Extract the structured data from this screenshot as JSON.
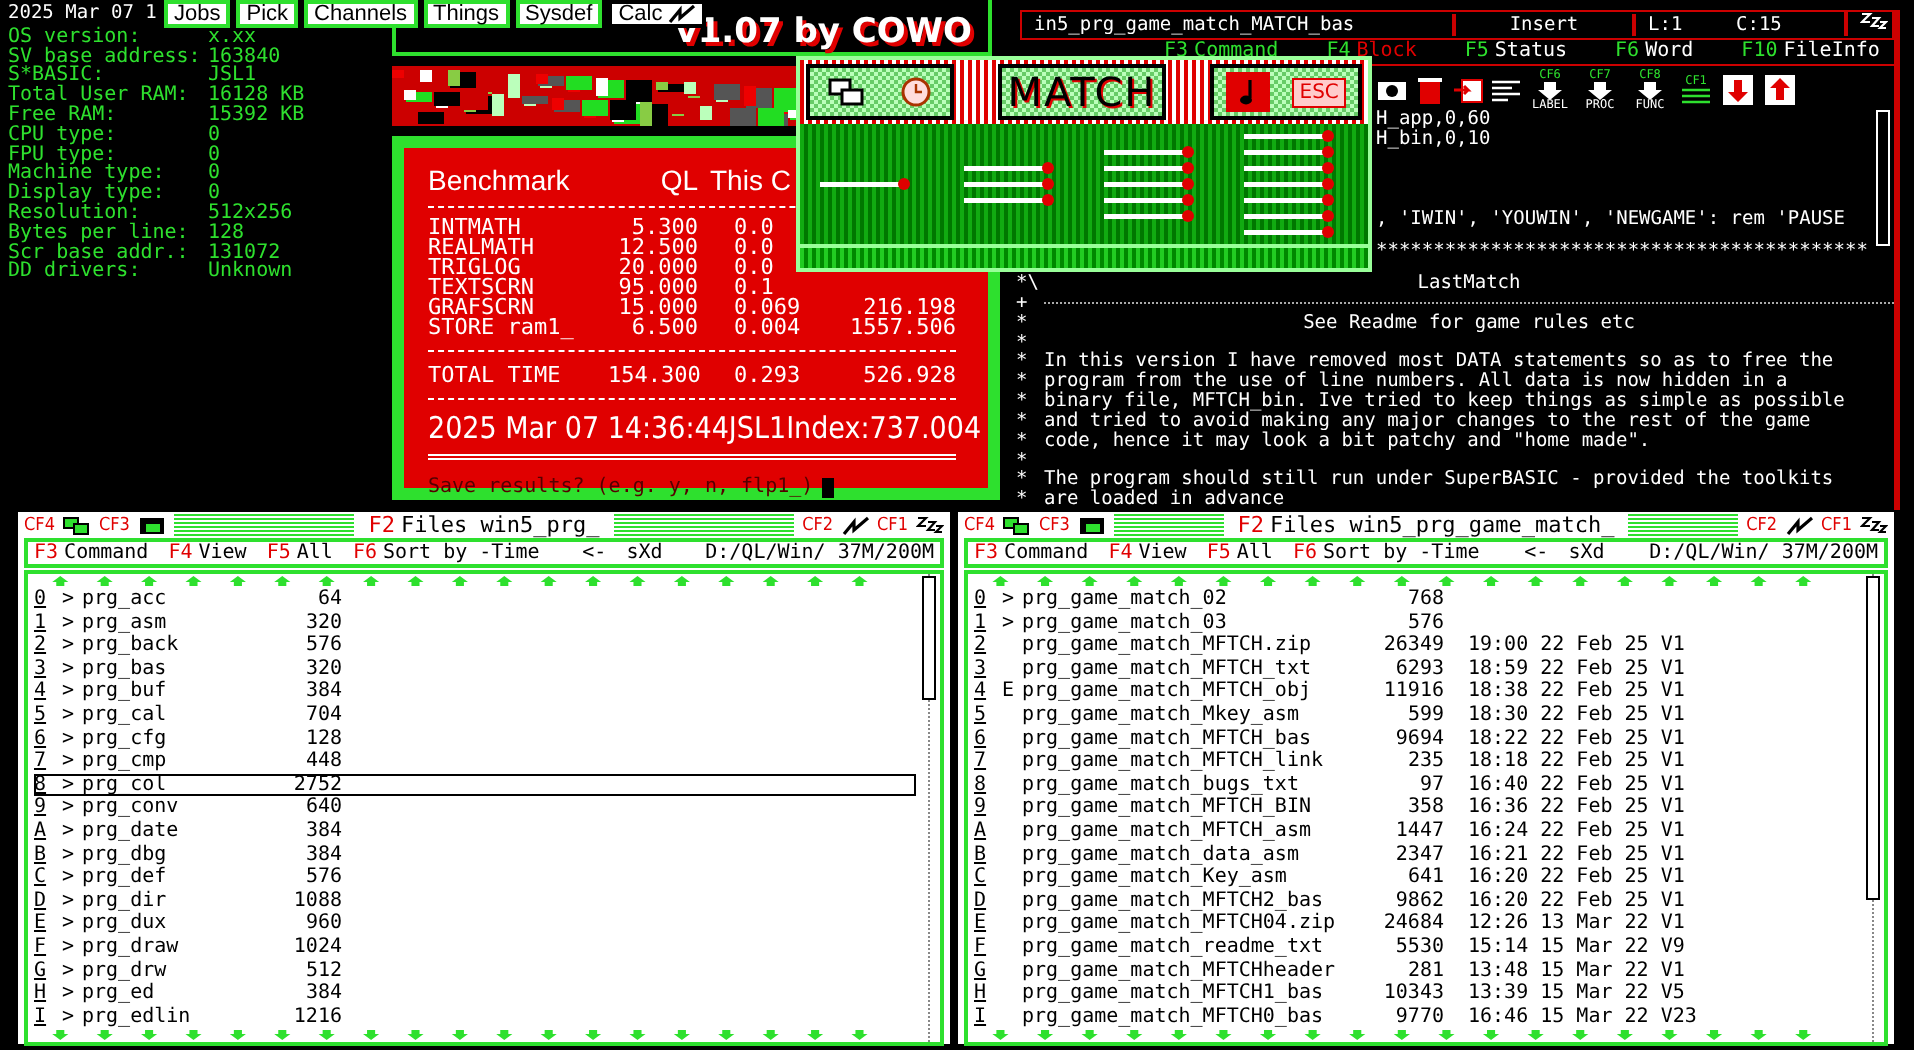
{
  "clock": {
    "text": "2025 Mar 07 1"
  },
  "launcher": {
    "buttons": [
      {
        "label": "Jobs",
        "kind": "text"
      },
      {
        "label": "Pick",
        "kind": "text"
      },
      {
        "label": "Channels",
        "kind": "text"
      },
      {
        "label": "Things",
        "kind": "text"
      },
      {
        "label": "Sysdef",
        "kind": "text"
      },
      {
        "label": "Calc",
        "kind": "icon"
      }
    ]
  },
  "sysinfo": {
    "rows": [
      {
        "label": "OS version:",
        "value": "x.xx"
      },
      {
        "label": "SV base address:",
        "value": "163840"
      },
      {
        "label": "S*BASIC:",
        "value": "JSL1"
      },
      {
        "label": "Total User RAM:",
        "value": "16128 KB"
      },
      {
        "label": "Free RAM:",
        "value": "15392 KB"
      },
      {
        "label": "CPU type:",
        "value": "0"
      },
      {
        "label": "FPU type:",
        "value": "0"
      },
      {
        "label": "Machine type:",
        "value": "0"
      },
      {
        "label": "Display type:",
        "value": "0"
      },
      {
        "label": "Resolution:",
        "value": "512x256"
      },
      {
        "label": "Bytes per line:",
        "value": "128"
      },
      {
        "label": "Scr base addr.:",
        "value": "131072"
      },
      {
        "label": "DD drivers:",
        "value": "Unknown"
      }
    ]
  },
  "title_window": {
    "title": "v1.07 by COWO"
  },
  "benchmark": {
    "title": "Benchmark",
    "col_ql": "QL",
    "col_this": "This C",
    "rows": [
      {
        "name": "INTMATH",
        "ql": "5.300",
        "this": "0.0"
      },
      {
        "name": "REALMATH",
        "ql": "12.500",
        "this": "0.0"
      },
      {
        "name": "TRIGLOG",
        "ql": "20.000",
        "this": "0.0"
      },
      {
        "name": "TEXTSCRN",
        "ql": "95.000",
        "this": "0.1"
      },
      {
        "name": "GRAFSCRN",
        "ql": "15.000",
        "this": "0.069",
        "index": "216.198"
      },
      {
        "name": "STORE ram1_",
        "ql": "6.500",
        "this": "0.004",
        "index": "1557.506"
      }
    ],
    "total": {
      "name": "TOTAL TIME",
      "ql": "154.300",
      "this": "0.293",
      "index": "526.928"
    },
    "result": {
      "date": "2025 Mar 07 14:36:44",
      "system": "JSL1",
      "label": "Index:",
      "value": "737.004"
    },
    "prompt": "Save results? (e.g. y, n, flp1_)"
  },
  "match_window": {
    "title": "MATCH",
    "esc": "ESC"
  },
  "editor": {
    "filename": "in5_prg_game_match_MATCH_bas",
    "mode": "Insert",
    "line": "L:1",
    "column": "C:15",
    "menu": [
      {
        "key": "F3",
        "label": "Command",
        "kind": "active"
      },
      {
        "key": "F4",
        "label": "Block",
        "kind": "marked"
      },
      {
        "key": "F5",
        "label": "Status",
        "kind": "plain"
      },
      {
        "key": "F6",
        "label": "Word",
        "kind": "plain"
      },
      {
        "key": "F10",
        "label": "FileInfo",
        "kind": "plain"
      }
    ],
    "toolbar": [
      {
        "key": "CF6",
        "label": "LABEL"
      },
      {
        "key": "CF7",
        "label": "PROC"
      },
      {
        "key": "CF8",
        "label": "FUNC"
      },
      {
        "key": "CF1"
      }
    ],
    "clipped_lines": [
      "H_app,0,60",
      "H_bin,0,10",
      ", 'IWIN', 'YOUWIN', 'NEWGAME': rem 'PAUSE",
      "*******************************************"
    ],
    "lines": [
      {
        "marker": "*\\",
        "text": "LastMatch",
        "kind": "center"
      },
      {
        "marker": "+",
        "kind": "rule"
      },
      {
        "marker": "*",
        "text": "See Readme for game rules etc",
        "kind": "center"
      },
      {
        "marker": "*",
        "kind": "blank"
      },
      {
        "marker": "*",
        "text": "In this version I have removed most DATA statements so as to free the",
        "kind": "left"
      },
      {
        "marker": "*",
        "text": "program from the use of line numbers. All data is now hidden in a",
        "kind": "left"
      },
      {
        "marker": "*",
        "text": "binary file, MFTCH_bin. Ive tried to keep things as simple as possible",
        "kind": "left"
      },
      {
        "marker": "*",
        "text": "and tried to avoid making any major changes to the rest of the game",
        "kind": "left"
      },
      {
        "marker": "*",
        "text": "code, hence it may look a bit patchy and \"home made\".",
        "kind": "left"
      },
      {
        "marker": "*",
        "kind": "blank"
      },
      {
        "marker": "*",
        "text": "The program should still run under SuperBASIC - provided the toolkits",
        "kind": "left"
      },
      {
        "marker": "*",
        "text": "are loaded in advance",
        "kind": "left"
      }
    ]
  },
  "file_windows": [
    {
      "title": {
        "key": "F2",
        "text": "Files win5_prg_"
      },
      "shortcuts": [
        "CF4",
        "CF3",
        "CF2",
        "CF1"
      ],
      "menu": [
        {
          "key": "F3",
          "label": "Command"
        },
        {
          "key": "F4",
          "label": "View"
        },
        {
          "key": "F5",
          "label": "All"
        },
        {
          "key": "F6",
          "label": "Sort by -Time"
        }
      ],
      "back": "<-",
      "mode": "sXd",
      "path": "D:/QL/Win/ 37M/200M",
      "rows": [
        {
          "key": "0",
          "marker": ">",
          "name": "prg_acc",
          "size": "64",
          "selected": false
        },
        {
          "key": "1",
          "marker": ">",
          "name": "prg_asm",
          "size": "320",
          "selected": false
        },
        {
          "key": "2",
          "marker": ">",
          "name": "prg_back",
          "size": "576",
          "selected": false
        },
        {
          "key": "3",
          "marker": ">",
          "name": "prg_bas",
          "size": "320",
          "selected": false
        },
        {
          "key": "4",
          "marker": ">",
          "name": "prg_buf",
          "size": "384",
          "selected": false
        },
        {
          "key": "5",
          "marker": ">",
          "name": "prg_cal",
          "size": "704",
          "selected": false
        },
        {
          "key": "6",
          "marker": ">",
          "name": "prg_cfg",
          "size": "128",
          "selected": false
        },
        {
          "key": "7",
          "marker": ">",
          "name": "prg_cmp",
          "size": "448",
          "selected": false
        },
        {
          "key": "8",
          "marker": ">",
          "name": "prg_col",
          "size": "2752",
          "selected": true
        },
        {
          "key": "9",
          "marker": ">",
          "name": "prg_conv",
          "size": "640",
          "selected": false
        },
        {
          "key": "A",
          "marker": ">",
          "name": "prg_date",
          "size": "384",
          "selected": false
        },
        {
          "key": "B",
          "marker": ">",
          "name": "prg_dbg",
          "size": "384",
          "selected": false
        },
        {
          "key": "C",
          "marker": ">",
          "name": "prg_def",
          "size": "576",
          "selected": false
        },
        {
          "key": "D",
          "marker": ">",
          "name": "prg_dir",
          "size": "1088",
          "selected": false
        },
        {
          "key": "E",
          "marker": ">",
          "name": "prg_dux",
          "size": "960",
          "selected": false
        },
        {
          "key": "F",
          "marker": ">",
          "name": "prg_draw",
          "size": "1024",
          "selected": false
        },
        {
          "key": "G",
          "marker": ">",
          "name": "prg_drw",
          "size": "512",
          "selected": false
        },
        {
          "key": "H",
          "marker": ">",
          "name": "prg_ed",
          "size": "384",
          "selected": false
        },
        {
          "key": "I",
          "marker": ">",
          "name": "prg_edlin",
          "size": "1216",
          "selected": false
        }
      ]
    },
    {
      "title": {
        "key": "F2",
        "text": "Files win5_prg_game_match_"
      },
      "shortcuts": [
        "CF4",
        "CF3",
        "CF2",
        "CF1"
      ],
      "menu": [
        {
          "key": "F3",
          "label": "Command"
        },
        {
          "key": "F4",
          "label": "View"
        },
        {
          "key": "F5",
          "label": "All"
        },
        {
          "key": "F6",
          "label": "Sort by -Time"
        }
      ],
      "back": "<-",
      "mode": "sXd",
      "path": "D:/QL/Win/ 37M/200M",
      "rows": [
        {
          "key": "0",
          "marker": ">",
          "name": "prg_game_match_02",
          "size": "768",
          "selected": false
        },
        {
          "key": "1",
          "marker": ">",
          "name": "prg_game_match_03",
          "size": "576",
          "selected": false
        },
        {
          "key": "2",
          "name": "prg_game_match_MFTCH.zip",
          "size": "26349",
          "info": "19:00 22 Feb 25 V1",
          "selected": false
        },
        {
          "key": "3",
          "name": "prg_game_match_MFTCH_txt",
          "size": "6293",
          "info": "18:59 22 Feb 25 V1",
          "selected": false
        },
        {
          "key": "4",
          "marker": "E",
          "name": "prg_game_match_MFTCH_obj",
          "size": "11916",
          "info": "18:38 22 Feb 25 V1",
          "selected": false
        },
        {
          "key": "5",
          "name": "prg_game_match_Mkey_asm",
          "size": "599",
          "info": "18:30 22 Feb 25 V1",
          "selected": false
        },
        {
          "key": "6",
          "name": "prg_game_match_MFTCH_bas",
          "size": "9694",
          "info": "18:22 22 Feb 25 V1",
          "selected": false
        },
        {
          "key": "7",
          "name": "prg_game_match_MFTCH_link",
          "size": "235",
          "info": "18:18 22 Feb 25 V1",
          "selected": false
        },
        {
          "key": "8",
          "name": "prg_game_match_bugs_txt",
          "size": "97",
          "info": "16:40 22 Feb 25 V1",
          "selected": false
        },
        {
          "key": "9",
          "name": "prg_game_match_MFTCH_BIN",
          "size": "358",
          "info": "16:36 22 Feb 25 V1",
          "selected": false
        },
        {
          "key": "A",
          "name": "prg_game_match_MFTCH_asm",
          "size": "1447",
          "info": "16:24 22 Feb 25 V1",
          "selected": false
        },
        {
          "key": "B",
          "name": "prg_game_match_data_asm",
          "size": "2347",
          "info": "16:21 22 Feb 25 V1",
          "selected": false
        },
        {
          "key": "C",
          "name": "prg_game_match_Key_asm",
          "size": "641",
          "info": "16:20 22 Feb 25 V1",
          "selected": false
        },
        {
          "key": "D",
          "name": "prg_game_match_MFTCH2_bas",
          "size": "9862",
          "info": "16:20 22 Feb 25 V1",
          "selected": false
        },
        {
          "key": "E",
          "name": "prg_game_match_MFTCH04.zip",
          "size": "24684",
          "info": "12:26 13 Mar 22 V1",
          "selected": false
        },
        {
          "key": "F",
          "name": "prg_game_match_readme_txt",
          "size": "5530",
          "info": "15:14 15 Mar 22 V9",
          "selected": false
        },
        {
          "key": "G",
          "name": "prg_game_match_MFTCHheader",
          "size": "281",
          "info": "13:48 15 Mar 22 V1",
          "selected": false
        },
        {
          "key": "H",
          "name": "prg_game_match_MFTCH1_bas",
          "size": "10343",
          "info": "13:39 15 Mar 22 V5",
          "selected": false
        },
        {
          "key": "I",
          "name": "prg_game_match_MFTCH0_bas",
          "size": "9770",
          "info": "16:46 15 Mar 22 V23",
          "selected": false
        }
      ]
    }
  ]
}
